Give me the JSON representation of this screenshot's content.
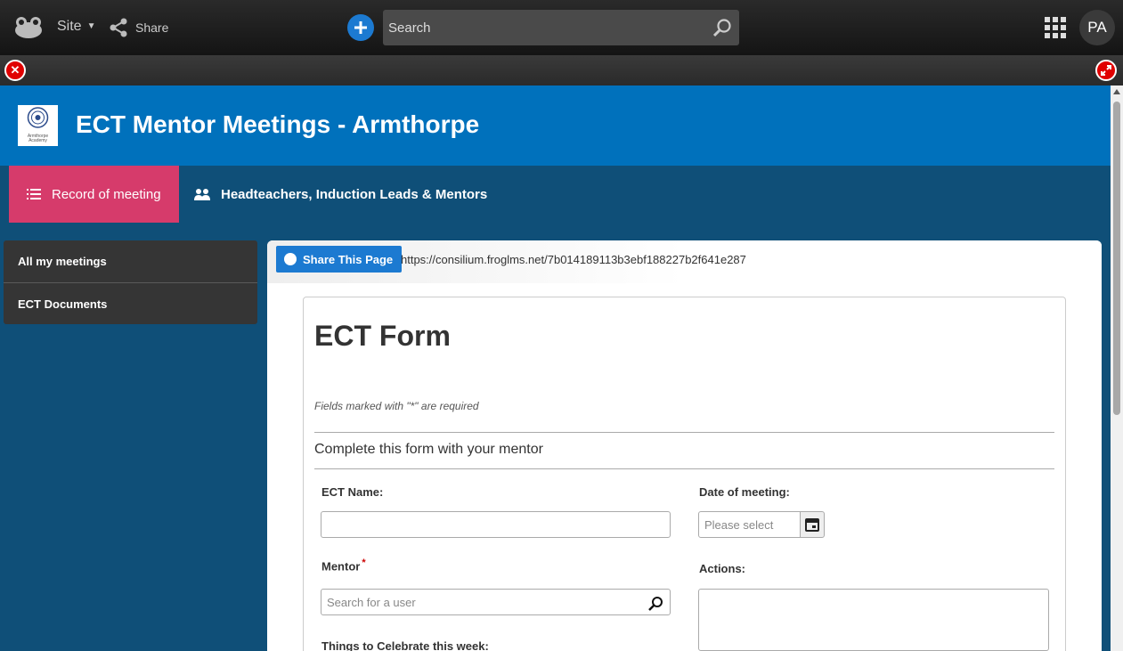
{
  "topbar": {
    "site_label": "Site",
    "share_label": "Share",
    "search_placeholder": "Search",
    "avatar_initials": "PA",
    "icons": [
      "frog-logo-icon",
      "caret-down-icon",
      "share-icon",
      "plus-icon",
      "search-icon",
      "apps-grid-icon"
    ]
  },
  "subbar": {
    "icons": [
      "close-icon",
      "expand-icon"
    ]
  },
  "header": {
    "title": "ECT Mentor Meetings - Armthorpe",
    "logo_text": "Armthorpe Academy",
    "accent": "#0071bc"
  },
  "nav": {
    "tabs": [
      {
        "label": "Record of meeting",
        "active": true,
        "icon": "list-icon"
      },
      {
        "label": "Headteachers, Induction Leads & Mentors",
        "active": false,
        "icon": "users-icon"
      }
    ],
    "active_color": "#d63b6b"
  },
  "sidebar": {
    "items": [
      {
        "label": "All my meetings"
      },
      {
        "label": "ECT Documents"
      }
    ]
  },
  "sharebar": {
    "button_label": "Share This Page",
    "url": "https://consilium.froglms.net/7b014189113b3ebf188227b2f641e287"
  },
  "form": {
    "title": "ECT Form",
    "required_note": "Fields marked with \"*\" are required",
    "section_title": "Complete this form with your mentor",
    "ect_name_label": "ECT Name:",
    "ect_name_value": "",
    "date_label": "Date of meeting:",
    "date_placeholder": "Please select",
    "mentor_label": "Mentor",
    "required_mark": "*",
    "mentor_placeholder": "Search for a user",
    "actions_label": "Actions:",
    "celebrate_label": "Things to Celebrate this week:"
  }
}
